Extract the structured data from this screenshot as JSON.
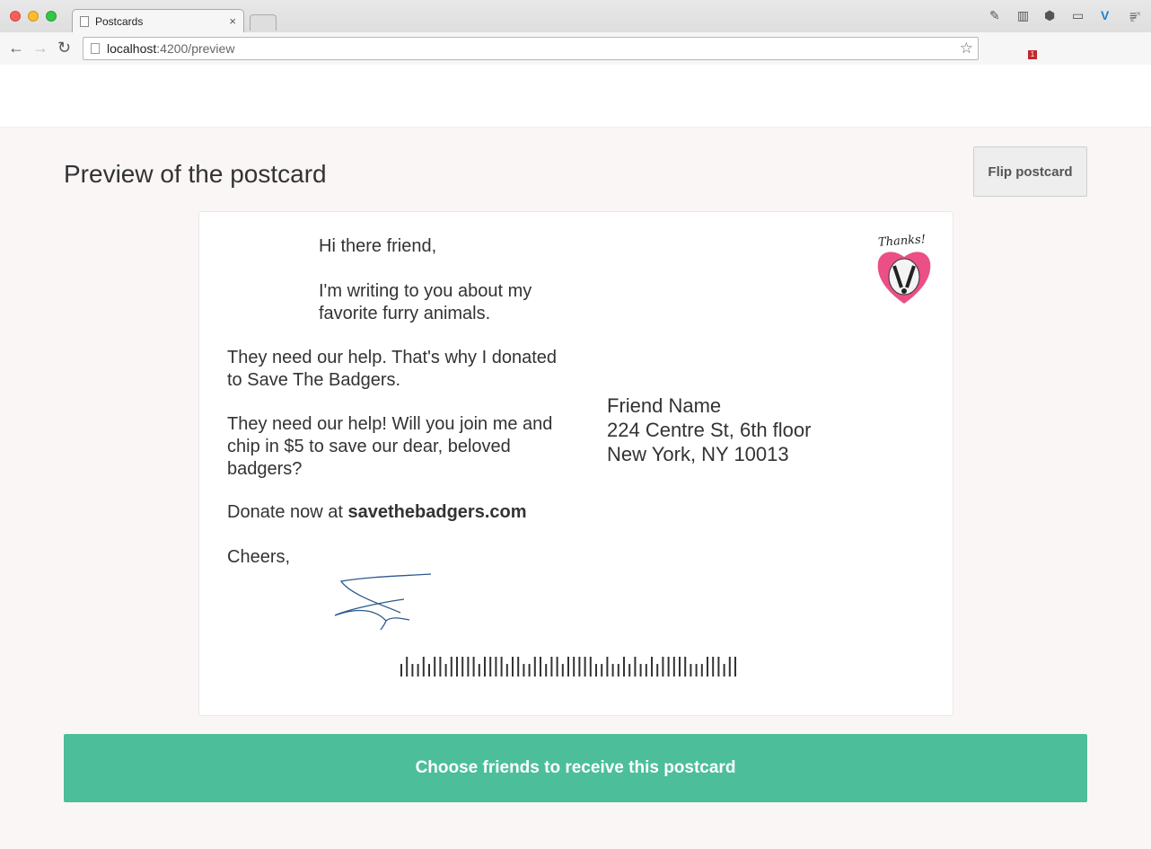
{
  "browser": {
    "tab_title": "Postcards",
    "tab_close": "×",
    "url_host": "localhost",
    "url_path": ":4200/preview",
    "extension_badge": "1"
  },
  "page": {
    "title": "Preview of the postcard",
    "flip_button": "Flip postcard",
    "cta_button": "Choose friends to receive this postcard",
    "cta_color": "#4cbe9a"
  },
  "postcard": {
    "greeting": "Hi there friend,",
    "para1": "I'm writing to you about my favorite furry animals.",
    "para2": "They need our help. That's why I donated to Save The Badgers.",
    "para3": "They need our help! Will you join me and chip in $5 to save our dear, beloved badgers?",
    "donate_prefix": "Donate now at ",
    "donate_link": "savethebadgers.com",
    "closing": "Cheers,",
    "stamp_text": "Thanks!",
    "address": {
      "name": "Friend Name",
      "street": "224 Centre St, 6th floor",
      "city": "New York, NY 10013"
    }
  }
}
